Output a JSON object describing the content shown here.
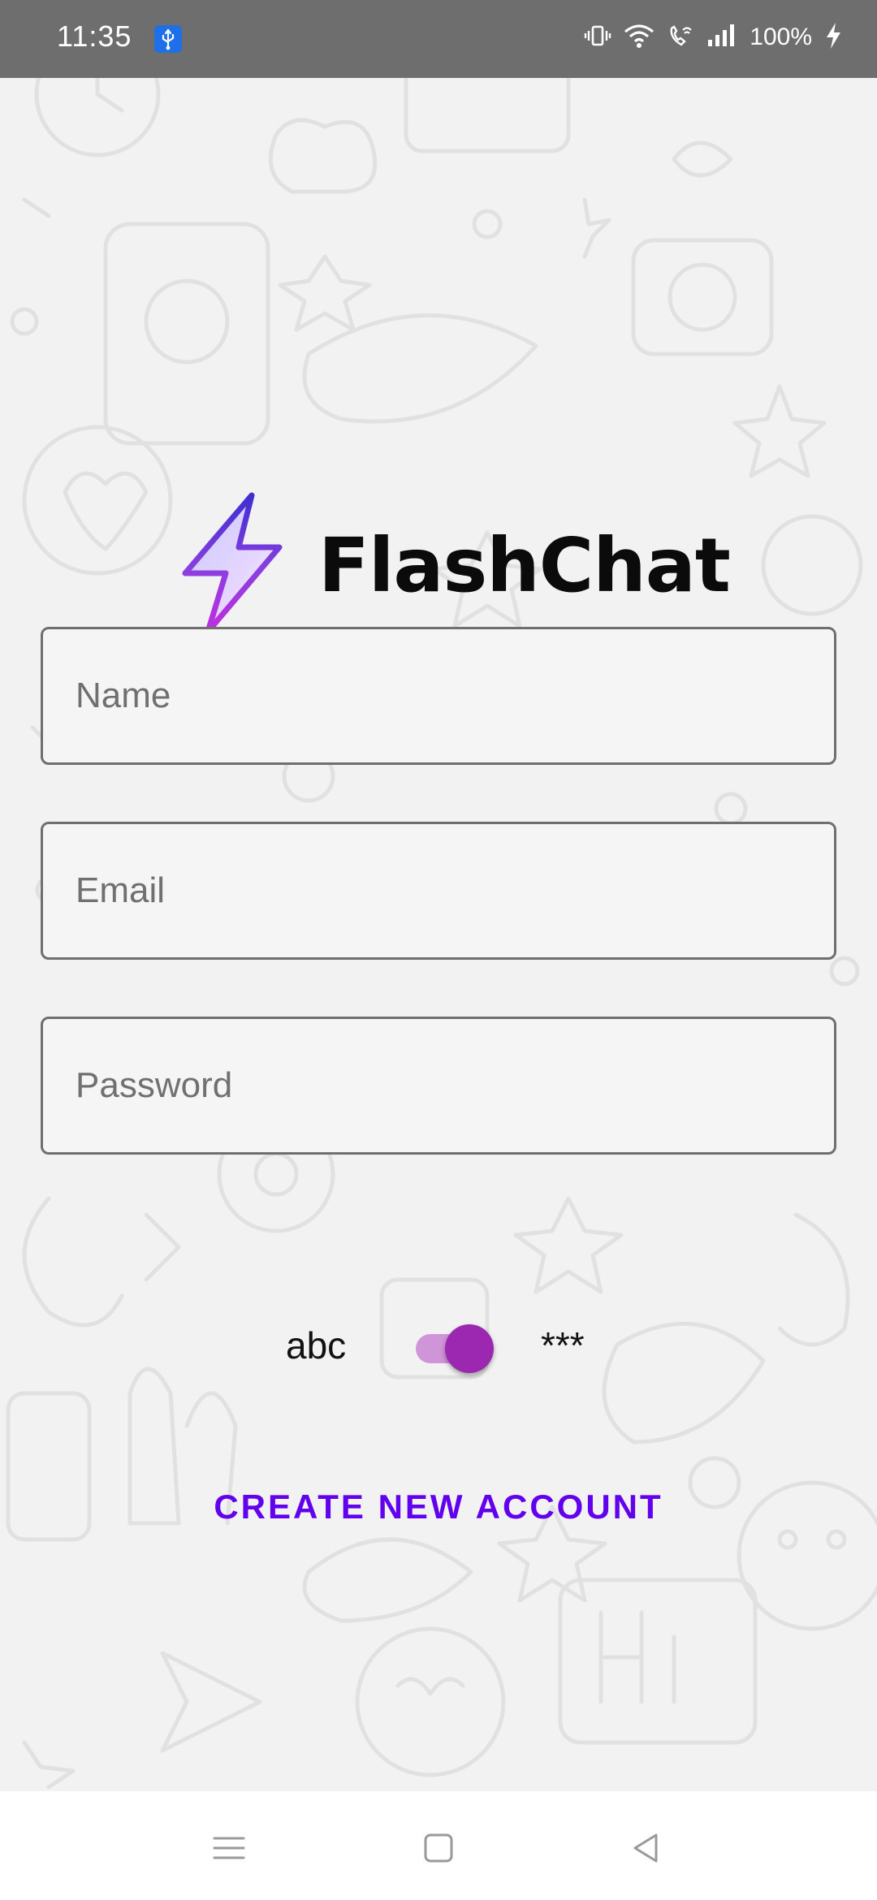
{
  "status_bar": {
    "time": "11:35",
    "usb_icon": "usb-debug-icon",
    "battery_text": "100%",
    "icons": [
      "vibrate-icon",
      "wifi-icon",
      "wifi-calling-icon",
      "signal-icon",
      "charging-icon"
    ]
  },
  "app": {
    "name": "FlashChat",
    "logo_icon": "lightning-bolt-icon",
    "accent_color": "#6200ee",
    "switch_color": "#9c27b0"
  },
  "form": {
    "name_placeholder": "Name",
    "email_placeholder": "Email",
    "password_placeholder": "Password",
    "name_value": "",
    "email_value": "",
    "password_value": ""
  },
  "password_toggle": {
    "left_label": "abc",
    "right_label": "***",
    "checked": true
  },
  "actions": {
    "create_account_label": "CREATE NEW ACCOUNT"
  },
  "nav_bar": {
    "icons": [
      "menu-icon",
      "home-icon",
      "back-icon"
    ]
  }
}
